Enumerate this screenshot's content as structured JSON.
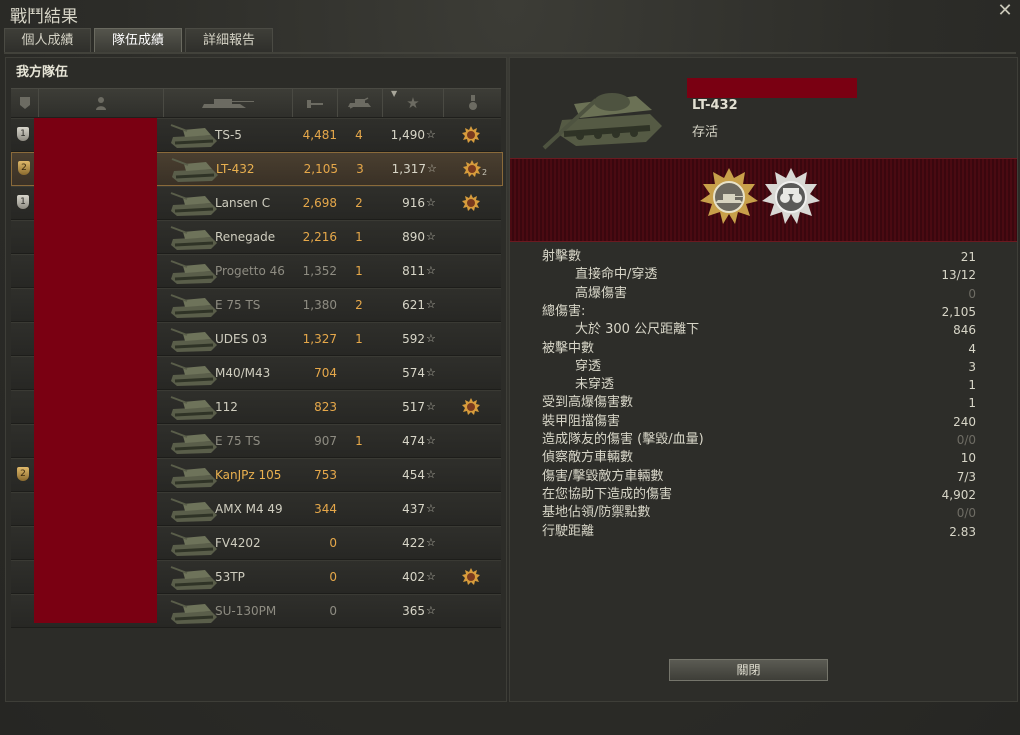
{
  "window": {
    "title": "戰鬥結果"
  },
  "tabs": [
    {
      "label": "個人成績",
      "active": false
    },
    {
      "label": "隊伍成績",
      "active": true
    },
    {
      "label": "詳細報告",
      "active": false
    }
  ],
  "team": {
    "title": "我方隊伍",
    "columns": [
      "platoon-icon",
      "player-icon",
      "tank-icon",
      "damage-icon",
      "kills-icon",
      "xp-star-icon",
      "medal-icon"
    ],
    "rows": [
      {
        "badge": "1",
        "badge_type": "silver",
        "vehicle": "TS-5",
        "damage": "4,481",
        "kills": "4",
        "xp": "1,490",
        "medal": true,
        "medal_count": "",
        "style": "normal"
      },
      {
        "badge": "2",
        "badge_type": "gold",
        "vehicle": "LT-432",
        "damage": "2,105",
        "kills": "3",
        "xp": "1,317",
        "medal": true,
        "medal_count": "2",
        "style": "selected"
      },
      {
        "badge": "1",
        "badge_type": "silver",
        "vehicle": "Lansen C",
        "damage": "2,698",
        "kills": "2",
        "xp": "916",
        "medal": true,
        "medal_count": "",
        "style": "normal"
      },
      {
        "badge": "",
        "badge_type": "",
        "vehicle": "Renegade",
        "damage": "2,216",
        "kills": "1",
        "xp": "890",
        "medal": false,
        "medal_count": "",
        "style": "normal"
      },
      {
        "badge": "",
        "badge_type": "",
        "vehicle": "Progetto 46",
        "damage": "1,352",
        "kills": "1",
        "xp": "811",
        "medal": false,
        "medal_count": "",
        "style": "dead"
      },
      {
        "badge": "",
        "badge_type": "",
        "vehicle": "E 75 TS",
        "damage": "1,380",
        "kills": "2",
        "xp": "621",
        "medal": false,
        "medal_count": "",
        "style": "dead"
      },
      {
        "badge": "",
        "badge_type": "",
        "vehicle": "UDES 03",
        "damage": "1,327",
        "kills": "1",
        "xp": "592",
        "medal": false,
        "medal_count": "",
        "style": "normal"
      },
      {
        "badge": "",
        "badge_type": "",
        "vehicle": "M40/M43",
        "damage": "704",
        "kills": "",
        "xp": "574",
        "medal": false,
        "medal_count": "",
        "style": "normal"
      },
      {
        "badge": "",
        "badge_type": "",
        "vehicle": "112",
        "damage": "823",
        "kills": "",
        "xp": "517",
        "medal": true,
        "medal_count": "",
        "style": "normal"
      },
      {
        "badge": "",
        "badge_type": "",
        "vehicle": "E 75 TS",
        "damage": "907",
        "kills": "1",
        "xp": "474",
        "medal": false,
        "medal_count": "",
        "style": "dead"
      },
      {
        "badge": "2",
        "badge_type": "gold",
        "vehicle": "KanJPz 105",
        "damage": "753",
        "kills": "",
        "xp": "454",
        "medal": false,
        "medal_count": "",
        "style": "platoon"
      },
      {
        "badge": "",
        "badge_type": "",
        "vehicle": "AMX M4 49",
        "damage": "344",
        "kills": "",
        "xp": "437",
        "medal": false,
        "medal_count": "",
        "style": "normal"
      },
      {
        "badge": "",
        "badge_type": "",
        "vehicle": "FV4202",
        "damage": "0",
        "kills": "",
        "xp": "422",
        "medal": false,
        "medal_count": "",
        "style": "normal"
      },
      {
        "badge": "",
        "badge_type": "",
        "vehicle": "53TP",
        "damage": "0",
        "kills": "",
        "xp": "402",
        "medal": true,
        "medal_count": "",
        "style": "normal"
      },
      {
        "badge": "",
        "badge_type": "",
        "vehicle": "SU-130PM",
        "damage": "0",
        "kills": "",
        "xp": "365",
        "medal": false,
        "medal_count": "",
        "style": "dead"
      }
    ]
  },
  "detail": {
    "vehicle": "LT-432",
    "status": "存活",
    "stats": [
      {
        "label": "射擊數",
        "value": "21",
        "sub": false,
        "dim": false
      },
      {
        "label": "直接命中/穿透",
        "value": "13/12",
        "sub": true,
        "dim": false
      },
      {
        "label": "高爆傷害",
        "value": "0",
        "sub": true,
        "dim": true
      },
      {
        "label": "總傷害:",
        "value": "2,105",
        "sub": false,
        "dim": false
      },
      {
        "label": "大於 300 公尺距離下",
        "value": "846",
        "sub": true,
        "dim": false
      },
      {
        "label": "被擊中數",
        "value": "4",
        "sub": false,
        "dim": false
      },
      {
        "label": "穿透",
        "value": "3",
        "sub": true,
        "dim": false
      },
      {
        "label": "未穿透",
        "value": "1",
        "sub": true,
        "dim": false
      },
      {
        "label": "受到高爆傷害數",
        "value": "1",
        "sub": false,
        "dim": false
      },
      {
        "label": "裝甲阻擋傷害",
        "value": "240",
        "sub": false,
        "dim": false
      },
      {
        "label": "造成隊友的傷害 (擊毀/血量)",
        "value": "0/0",
        "sub": false,
        "dim": true
      },
      {
        "label": "偵察敵方車輛數",
        "value": "10",
        "sub": false,
        "dim": false
      },
      {
        "label": "傷害/擊毀敵方車輛數",
        "value": "7/3",
        "sub": false,
        "dim": false
      },
      {
        "label": "在您協助下造成的傷害",
        "value": "4,902",
        "sub": false,
        "dim": false
      },
      {
        "label": "基地佔領/防禦點數",
        "value": "0/0",
        "sub": false,
        "dim": true
      },
      {
        "label": "行駛距離",
        "value": "2.83",
        "sub": false,
        "dim": false
      }
    ],
    "close_label": "關閉"
  },
  "colors": {
    "accent": "#e6a84a",
    "redaction": "#7a0012",
    "medal_band": "#4a0a12"
  }
}
